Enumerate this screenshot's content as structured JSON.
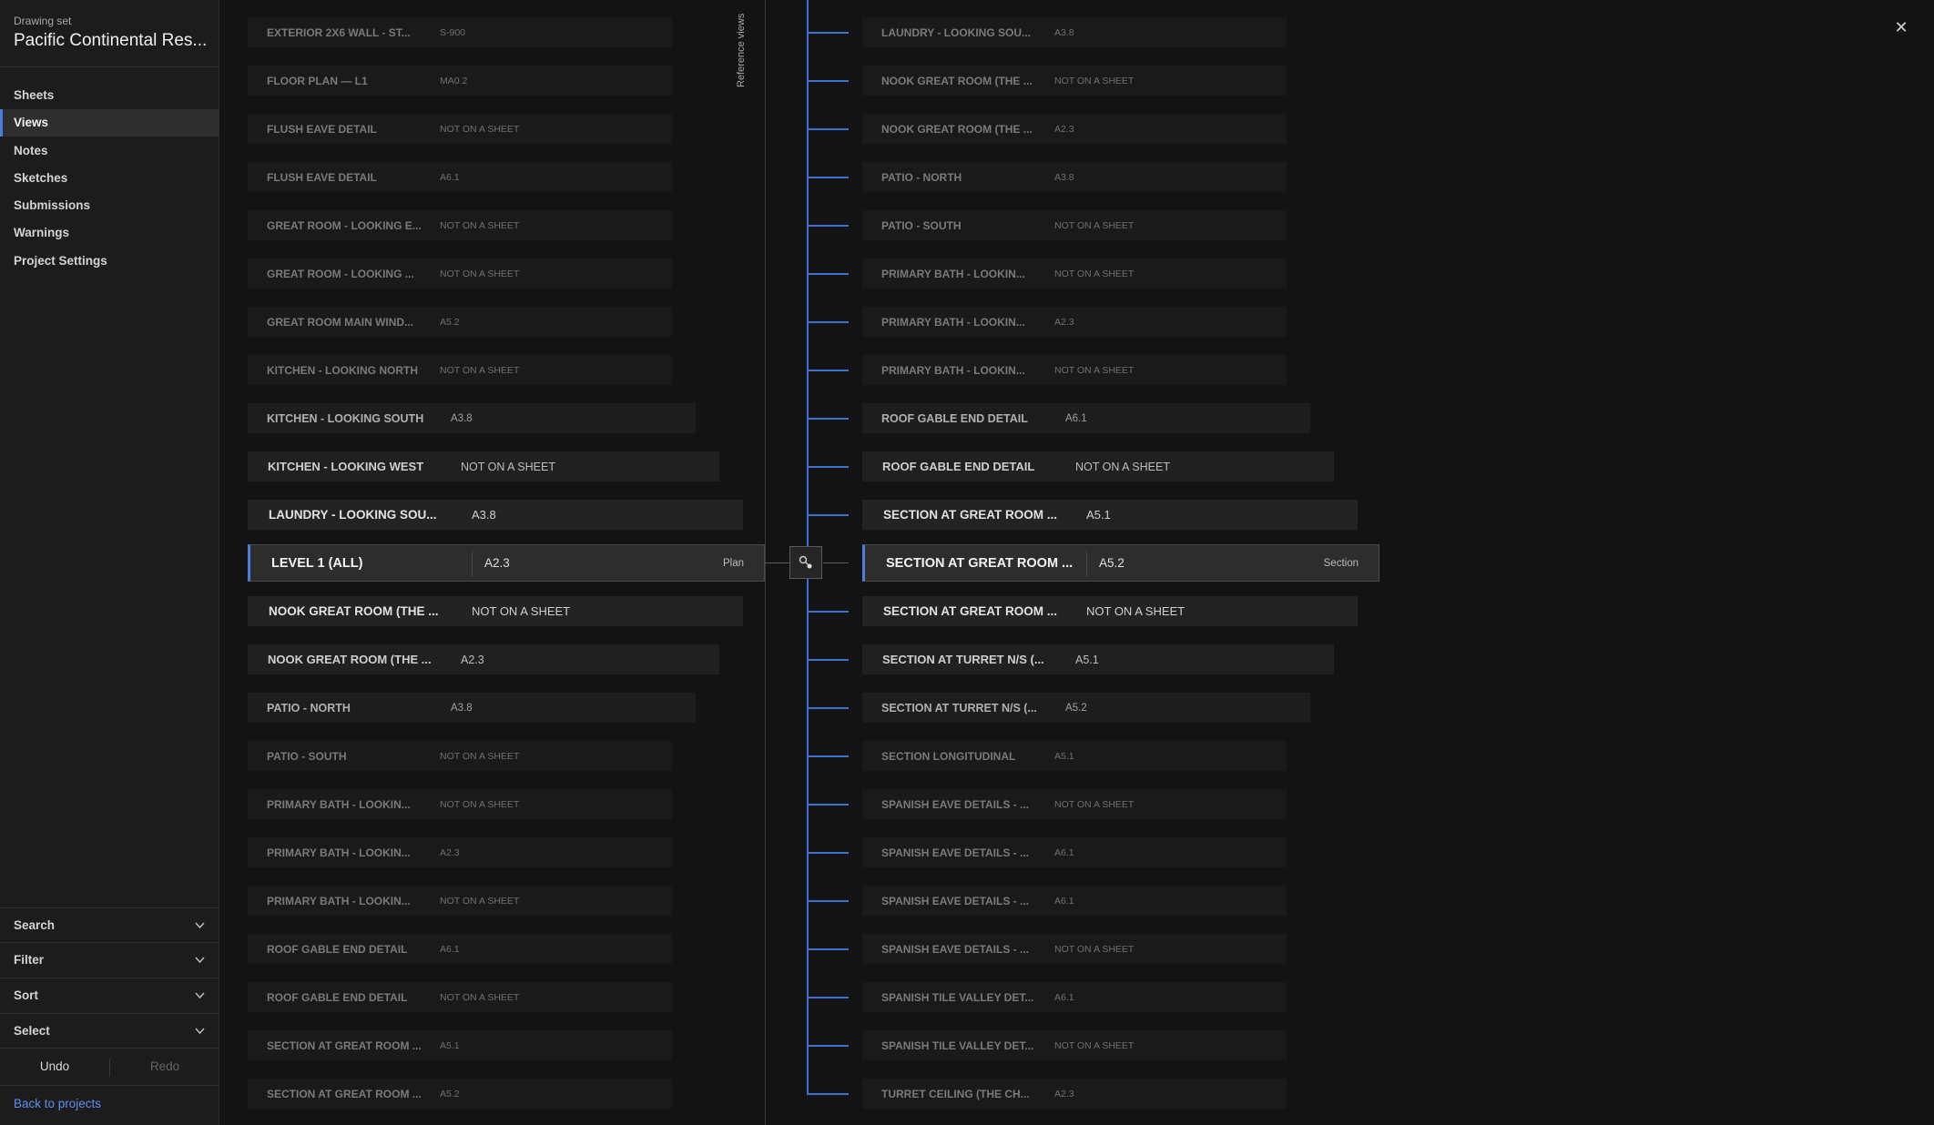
{
  "sidebar": {
    "drawing_set_label": "Drawing set",
    "project_title": "Pacific Continental Res...",
    "nav": [
      {
        "label": "Sheets",
        "active": false
      },
      {
        "label": "Views",
        "active": true
      },
      {
        "label": "Notes",
        "active": false
      },
      {
        "label": "Sketches",
        "active": false
      },
      {
        "label": "Submissions",
        "active": false
      },
      {
        "label": "Warnings",
        "active": false
      },
      {
        "label": "Project Settings",
        "active": false
      }
    ],
    "search_label": "Search",
    "filter_label": "Filter",
    "sort_label": "Sort",
    "select_label": "Select",
    "undo_label": "Undo",
    "redo_label": "Redo",
    "back_label": "Back to projects"
  },
  "reference_views_label": "Reference views",
  "left_views": [
    {
      "name": "EXTERIOR 2X6 WALL - ST...",
      "sheet": "S-900"
    },
    {
      "name": "FLOOR PLAN — L1",
      "sheet": "MA0.2"
    },
    {
      "name": "FLUSH EAVE DETAIL",
      "sheet": "NOT ON A SHEET"
    },
    {
      "name": "FLUSH EAVE DETAIL",
      "sheet": "A6.1"
    },
    {
      "name": "GREAT ROOM - LOOKING E...",
      "sheet": "NOT ON A SHEET"
    },
    {
      "name": "GREAT ROOM - LOOKING ...",
      "sheet": "NOT ON A SHEET"
    },
    {
      "name": "GREAT ROOM MAIN WIND...",
      "sheet": "A5.2"
    },
    {
      "name": "KITCHEN - LOOKING NORTH",
      "sheet": "NOT ON A SHEET"
    },
    {
      "name": "KITCHEN - LOOKING SOUTH",
      "sheet": "A3.8"
    },
    {
      "name": "KITCHEN - LOOKING WEST",
      "sheet": "NOT ON A SHEET"
    },
    {
      "name": "LAUNDRY - LOOKING SOU...",
      "sheet": "A3.8"
    },
    {
      "name": "LEVEL 1 (ALL)",
      "sheet": "A2.3",
      "type": "Plan"
    },
    {
      "name": "NOOK GREAT ROOM (THE ...",
      "sheet": "NOT ON A SHEET"
    },
    {
      "name": "NOOK GREAT ROOM (THE ...",
      "sheet": "A2.3"
    },
    {
      "name": "PATIO - NORTH",
      "sheet": "A3.8"
    },
    {
      "name": "PATIO - SOUTH",
      "sheet": "NOT ON A SHEET"
    },
    {
      "name": "PRIMARY BATH - LOOKIN...",
      "sheet": "NOT ON A SHEET"
    },
    {
      "name": "PRIMARY BATH - LOOKIN...",
      "sheet": "A2.3"
    },
    {
      "name": "PRIMARY BATH - LOOKIN...",
      "sheet": "NOT ON A SHEET"
    },
    {
      "name": "ROOF GABLE END DETAIL",
      "sheet": "A6.1"
    },
    {
      "name": "ROOF GABLE END DETAIL",
      "sheet": "NOT ON A SHEET"
    },
    {
      "name": "SECTION AT GREAT ROOM ...",
      "sheet": "A5.1"
    },
    {
      "name": "SECTION AT GREAT ROOM ...",
      "sheet": "A5.2"
    }
  ],
  "right_views": [
    {
      "name": "LAUNDRY - LOOKING SOU...",
      "sheet": "A3.8"
    },
    {
      "name": "NOOK GREAT ROOM (THE ...",
      "sheet": "NOT ON A SHEET"
    },
    {
      "name": "NOOK GREAT ROOM (THE ...",
      "sheet": "A2.3"
    },
    {
      "name": "PATIO - NORTH",
      "sheet": "A3.8"
    },
    {
      "name": "PATIO - SOUTH",
      "sheet": "NOT ON A SHEET"
    },
    {
      "name": "PRIMARY BATH - LOOKIN...",
      "sheet": "NOT ON A SHEET"
    },
    {
      "name": "PRIMARY BATH - LOOKIN...",
      "sheet": "A2.3"
    },
    {
      "name": "PRIMARY BATH - LOOKIN...",
      "sheet": "NOT ON A SHEET"
    },
    {
      "name": "ROOF GABLE END DETAIL",
      "sheet": "A6.1"
    },
    {
      "name": "ROOF GABLE END DETAIL",
      "sheet": "NOT ON A SHEET"
    },
    {
      "name": "SECTION AT GREAT ROOM ...",
      "sheet": "A5.1"
    },
    {
      "name": "SECTION AT GREAT ROOM ...",
      "sheet": "A5.2",
      "type": "Section"
    },
    {
      "name": "SECTION AT GREAT ROOM ...",
      "sheet": "NOT ON A SHEET"
    },
    {
      "name": "SECTION AT TURRET N/S (...",
      "sheet": "A5.1"
    },
    {
      "name": "SECTION AT TURRET N/S (...",
      "sheet": "A5.2"
    },
    {
      "name": "SECTION LONGITUDINAL",
      "sheet": "A5.1"
    },
    {
      "name": "SPANISH EAVE DETAILS - ...",
      "sheet": "NOT ON A SHEET"
    },
    {
      "name": "SPANISH EAVE DETAILS - ...",
      "sheet": "A6.1"
    },
    {
      "name": "SPANISH EAVE DETAILS - ...",
      "sheet": "A6.1"
    },
    {
      "name": "SPANISH EAVE DETAILS - ...",
      "sheet": "NOT ON A SHEET"
    },
    {
      "name": "SPANISH TILE VALLEY DET...",
      "sheet": "A6.1"
    },
    {
      "name": "SPANISH TILE VALLEY DET...",
      "sheet": "NOT ON A SHEET"
    },
    {
      "name": "TURRET CEILING (THE CH...",
      "sheet": "A2.3"
    }
  ],
  "close_icon": "close-icon",
  "connector_icon": "link-node-icon",
  "colors": {
    "accent": "#4f7ddf",
    "connector": "#3f6fd1",
    "link": "#5d8ff0"
  }
}
